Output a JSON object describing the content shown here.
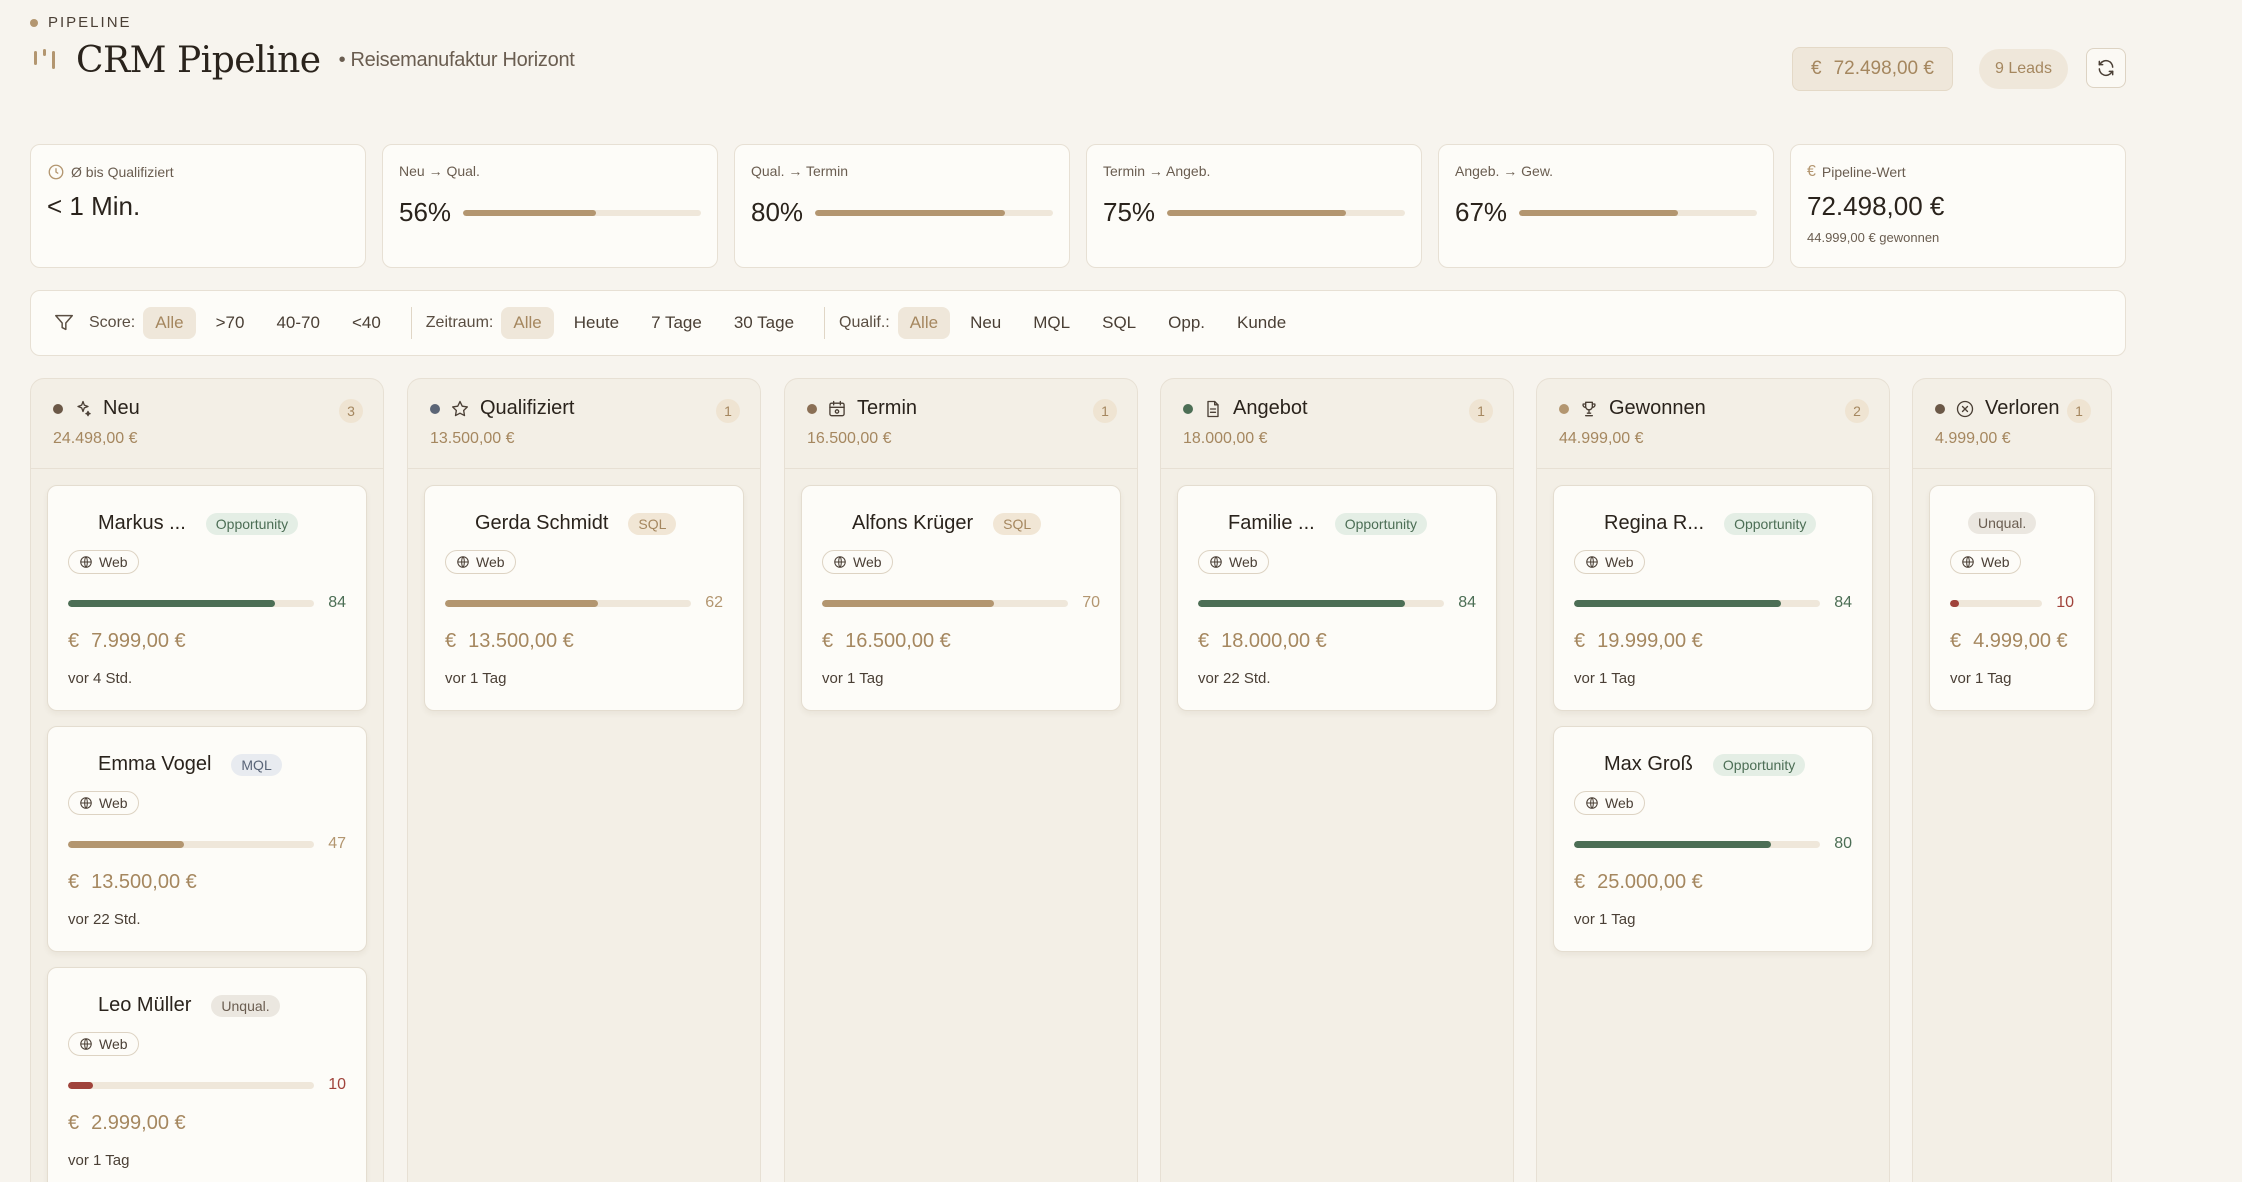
{
  "header": {
    "eyebrow": "PIPELINE",
    "title": "CRM Pipeline",
    "subtitle": "• Reisemanufaktur Horizont",
    "total_currency": "€",
    "total": "72.498,00 €",
    "leads": "9 Leads"
  },
  "kpis": {
    "avg": {
      "label": "Ø bis Qualifiziert",
      "value": "< 1 Min."
    },
    "conversions": [
      {
        "label": "Neu → Qual.",
        "value": "56%",
        "level": 0.56
      },
      {
        "label": "Qual. → Termin",
        "value": "80%",
        "level": 0.8
      },
      {
        "label": "Termin → Angeb.",
        "value": "75%",
        "level": 0.75
      },
      {
        "label": "Angeb. → Gew.",
        "value": "67%",
        "level": 0.67
      }
    ],
    "pipeline": {
      "currency": "€",
      "label": "Pipeline-Wert",
      "value": "72.498,00 €",
      "sub": "44.999,00 € gewonnen"
    }
  },
  "filters": {
    "score": {
      "label": "Score:",
      "options": [
        "Alle",
        ">70",
        "40-70",
        "<40"
      ],
      "active": "Alle"
    },
    "period": {
      "label": "Zeitraum:",
      "options": [
        "Alle",
        "Heute",
        "7 Tage",
        "30 Tage"
      ],
      "active": "Alle"
    },
    "qualif": {
      "label": "Qualif.:",
      "options": [
        "Alle",
        "Neu",
        "MQL",
        "SQL",
        "Opp.",
        "Kunde"
      ],
      "active": "Alle"
    }
  },
  "colors": {
    "accent": "#b39670",
    "green": "#4c6e55",
    "red": "#a0433b"
  },
  "columns": [
    {
      "title": "Neu",
      "count": "3",
      "sum": "24.498,00 €",
      "dot": "#6b5847",
      "icon": "sparkles-icon",
      "cards": [
        {
          "name": "Markus ...",
          "badge": "Opportunity",
          "badge_type": "opp",
          "source": "Web",
          "score": 84,
          "amount": "7.999,00 €",
          "time": "vor 4 Std."
        },
        {
          "name": "Emma Vogel",
          "badge": "MQL",
          "badge_type": "mql",
          "source": "Web",
          "score": 47,
          "amount": "13.500,00 €",
          "time": "vor 22 Std."
        },
        {
          "name": "Leo Müller",
          "badge": "Unqual.",
          "badge_type": "unq",
          "source": "Web",
          "score": 10,
          "amount": "2.999,00 €",
          "time": "vor 1 Tag"
        }
      ]
    },
    {
      "title": "Qualifiziert",
      "count": "1",
      "sum": "13.500,00 €",
      "dot": "#5b6576",
      "icon": "star-icon",
      "cards": [
        {
          "name": "Gerda Schmidt",
          "badge": "SQL",
          "badge_type": "sql",
          "source": "Web",
          "score": 62,
          "amount": "13.500,00 €",
          "time": "vor 1 Tag"
        }
      ]
    },
    {
      "title": "Termin",
      "count": "1",
      "sum": "16.500,00 €",
      "dot": "#8a6f55",
      "icon": "calendar-icon",
      "cards": [
        {
          "name": "Alfons Krüger",
          "badge": "SQL",
          "badge_type": "sql",
          "source": "Web",
          "score": 70,
          "amount": "16.500,00 €",
          "time": "vor 1 Tag"
        }
      ]
    },
    {
      "title": "Angebot",
      "count": "1",
      "sum": "18.000,00 €",
      "dot": "#4c6e55",
      "icon": "document-icon",
      "cards": [
        {
          "name": "Familie ...",
          "badge": "Opportunity",
          "badge_type": "opp",
          "source": "Web",
          "score": 84,
          "amount": "18.000,00 €",
          "time": "vor 22 Std."
        }
      ]
    },
    {
      "title": "Gewonnen",
      "count": "2",
      "sum": "44.999,00 €",
      "dot": "#b39670",
      "icon": "trophy-icon",
      "cards": [
        {
          "name": "Regina R...",
          "badge": "Opportunity",
          "badge_type": "opp",
          "source": "Web",
          "score": 84,
          "amount": "19.999,00 €",
          "time": "vor 1 Tag"
        },
        {
          "name": "Max Groß",
          "badge": "Opportunity",
          "badge_type": "opp",
          "source": "Web",
          "score": 80,
          "amount": "25.000,00 €",
          "time": "vor 1 Tag"
        }
      ]
    },
    {
      "title": "Verloren",
      "count": "1",
      "sum": "4.999,00 €",
      "dot": "#6b5847",
      "icon": "x-circle-icon",
      "cards": [
        {
          "name": "",
          "badge": "Unqual.",
          "badge_type": "unq",
          "source": "Web",
          "score": 10,
          "amount": "4.999,00 €",
          "time": "vor 1 Tag"
        }
      ]
    }
  ],
  "card_currency": "€"
}
